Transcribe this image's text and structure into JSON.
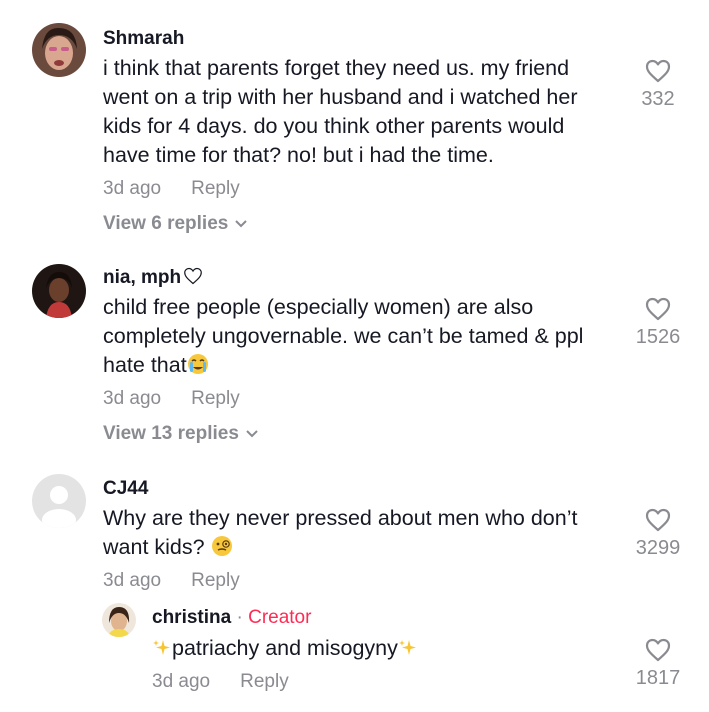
{
  "comments": [
    {
      "username": "Shmarah",
      "lines": [
        "i think that parents forget they need us. my friend",
        "went on a trip with her husband and i watched her",
        "kids for 4 days. do you think other parents would",
        "have time for that? no! but i had the time."
      ],
      "time": "3d ago",
      "reply_label": "Reply",
      "view_replies": "View 6 replies",
      "likes": "332"
    },
    {
      "username": "nia, mph",
      "lines": [
        "child free people (especially women) are also",
        "completely ungovernable. we can’t be tamed & ppl",
        "hate that"
      ],
      "time": "3d ago",
      "reply_label": "Reply",
      "view_replies": "View 13 replies",
      "likes": "1526"
    },
    {
      "username": "CJ44",
      "lines": [
        "Why are they never pressed about men who don’t",
        "want kids?"
      ],
      "time": "3d ago",
      "reply_label": "Reply",
      "likes": "3299",
      "reply": {
        "username": "christina",
        "separator": "·",
        "badge": "Creator",
        "text": "patriachy and misogyny",
        "time": "3d ago",
        "reply_label": "Reply",
        "likes": "1817"
      }
    }
  ],
  "colors": {
    "text": "#161823",
    "muted": "#8a8b91",
    "creator": "#fe2c55"
  }
}
